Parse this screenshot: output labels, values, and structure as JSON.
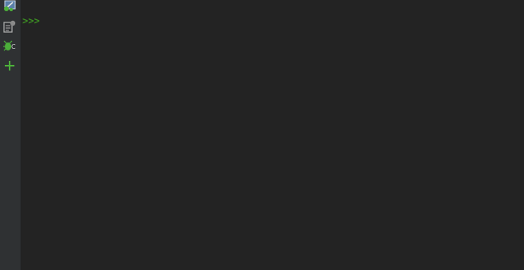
{
  "toolbar": {
    "items": [
      {
        "name": "python-console-icon"
      },
      {
        "name": "show-variables-icon"
      },
      {
        "name": "debug-icon"
      },
      {
        "name": "new-console-icon"
      }
    ]
  },
  "console": {
    "prompt": ">>>",
    "input_value": ""
  },
  "colors": {
    "background": "#232323",
    "toolbar": "#2f3133",
    "prompt": "#3c8d23",
    "accent_green": "#4caf3a"
  }
}
